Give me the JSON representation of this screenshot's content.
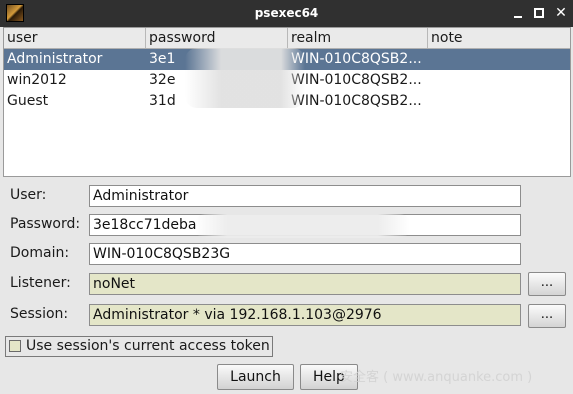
{
  "window": {
    "title": "psexec64"
  },
  "table": {
    "headers": [
      "user",
      "password",
      "realm",
      "note"
    ],
    "rows": [
      {
        "user": "Administrator",
        "password": "3e1",
        "realm": "WIN-010C8QSB2...",
        "note": "",
        "selected": true
      },
      {
        "user": "win2012",
        "password": "32e",
        "realm": "WIN-010C8QSB2...",
        "note": ""
      },
      {
        "user": "Guest",
        "password": "31d",
        "realm": "WIN-010C8QSB2...",
        "note": ""
      }
    ]
  },
  "form": {
    "user_label": "User:",
    "user_value": "Administrator",
    "password_label": "Password:",
    "password_value": "3e18cc71deba",
    "domain_label": "Domain:",
    "domain_value": "WIN-010C8QSB23G",
    "listener_label": "Listener:",
    "listener_value": "noNet",
    "session_label": "Session:",
    "session_value": "Administrator * via  192.168.1.103@2976",
    "browse_label": "...",
    "checkbox_label": "Use session's current access token",
    "checkbox_checked": false
  },
  "buttons": {
    "launch": "Launch",
    "help": "Help"
  },
  "watermark": "安全客 ( www.anquanke.com )"
}
